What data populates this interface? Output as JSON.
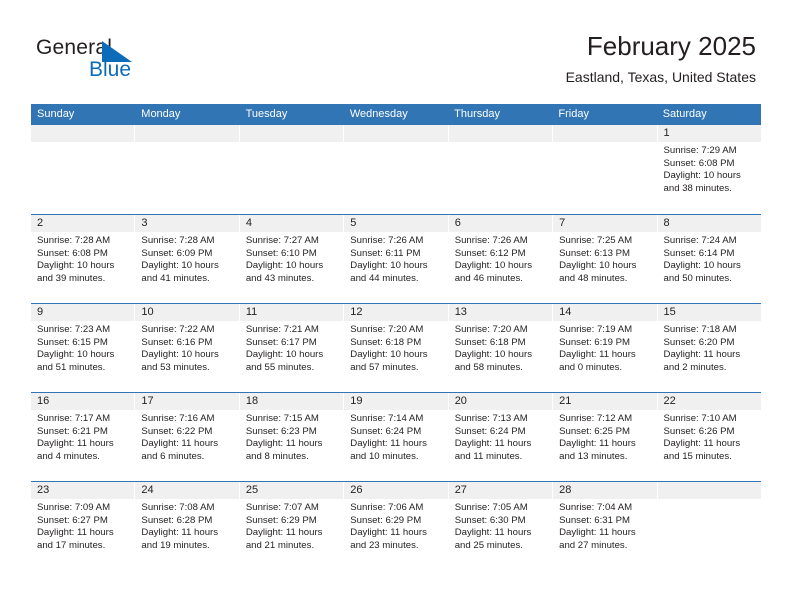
{
  "logo": {
    "word_one": "General",
    "word_two": "Blue",
    "triangle_color": "#0d6cb9",
    "text_color": "#231f20"
  },
  "header": {
    "title": "February 2025",
    "subtitle": "Eastland, Texas, United States"
  },
  "theme": {
    "header_blue": "#3175b4",
    "day_band_gray": "#f0f0f0",
    "text": "#231f20",
    "accent_blue": "#0d6cb9"
  },
  "weekdays": [
    "Sunday",
    "Monday",
    "Tuesday",
    "Wednesday",
    "Thursday",
    "Friday",
    "Saturday"
  ],
  "weeks": [
    [
      {
        "day": "",
        "sunrise": "",
        "sunset": "",
        "daylight": ""
      },
      {
        "day": "",
        "sunrise": "",
        "sunset": "",
        "daylight": ""
      },
      {
        "day": "",
        "sunrise": "",
        "sunset": "",
        "daylight": ""
      },
      {
        "day": "",
        "sunrise": "",
        "sunset": "",
        "daylight": ""
      },
      {
        "day": "",
        "sunrise": "",
        "sunset": "",
        "daylight": ""
      },
      {
        "day": "",
        "sunrise": "",
        "sunset": "",
        "daylight": ""
      },
      {
        "day": "1",
        "sunrise": "Sunrise: 7:29 AM",
        "sunset": "Sunset: 6:08 PM",
        "daylight": "Daylight: 10 hours and 38 minutes."
      }
    ],
    [
      {
        "day": "2",
        "sunrise": "Sunrise: 7:28 AM",
        "sunset": "Sunset: 6:08 PM",
        "daylight": "Daylight: 10 hours and 39 minutes."
      },
      {
        "day": "3",
        "sunrise": "Sunrise: 7:28 AM",
        "sunset": "Sunset: 6:09 PM",
        "daylight": "Daylight: 10 hours and 41 minutes."
      },
      {
        "day": "4",
        "sunrise": "Sunrise: 7:27 AM",
        "sunset": "Sunset: 6:10 PM",
        "daylight": "Daylight: 10 hours and 43 minutes."
      },
      {
        "day": "5",
        "sunrise": "Sunrise: 7:26 AM",
        "sunset": "Sunset: 6:11 PM",
        "daylight": "Daylight: 10 hours and 44 minutes."
      },
      {
        "day": "6",
        "sunrise": "Sunrise: 7:26 AM",
        "sunset": "Sunset: 6:12 PM",
        "daylight": "Daylight: 10 hours and 46 minutes."
      },
      {
        "day": "7",
        "sunrise": "Sunrise: 7:25 AM",
        "sunset": "Sunset: 6:13 PM",
        "daylight": "Daylight: 10 hours and 48 minutes."
      },
      {
        "day": "8",
        "sunrise": "Sunrise: 7:24 AM",
        "sunset": "Sunset: 6:14 PM",
        "daylight": "Daylight: 10 hours and 50 minutes."
      }
    ],
    [
      {
        "day": "9",
        "sunrise": "Sunrise: 7:23 AM",
        "sunset": "Sunset: 6:15 PM",
        "daylight": "Daylight: 10 hours and 51 minutes."
      },
      {
        "day": "10",
        "sunrise": "Sunrise: 7:22 AM",
        "sunset": "Sunset: 6:16 PM",
        "daylight": "Daylight: 10 hours and 53 minutes."
      },
      {
        "day": "11",
        "sunrise": "Sunrise: 7:21 AM",
        "sunset": "Sunset: 6:17 PM",
        "daylight": "Daylight: 10 hours and 55 minutes."
      },
      {
        "day": "12",
        "sunrise": "Sunrise: 7:20 AM",
        "sunset": "Sunset: 6:18 PM",
        "daylight": "Daylight: 10 hours and 57 minutes."
      },
      {
        "day": "13",
        "sunrise": "Sunrise: 7:20 AM",
        "sunset": "Sunset: 6:18 PM",
        "daylight": "Daylight: 10 hours and 58 minutes."
      },
      {
        "day": "14",
        "sunrise": "Sunrise: 7:19 AM",
        "sunset": "Sunset: 6:19 PM",
        "daylight": "Daylight: 11 hours and 0 minutes."
      },
      {
        "day": "15",
        "sunrise": "Sunrise: 7:18 AM",
        "sunset": "Sunset: 6:20 PM",
        "daylight": "Daylight: 11 hours and 2 minutes."
      }
    ],
    [
      {
        "day": "16",
        "sunrise": "Sunrise: 7:17 AM",
        "sunset": "Sunset: 6:21 PM",
        "daylight": "Daylight: 11 hours and 4 minutes."
      },
      {
        "day": "17",
        "sunrise": "Sunrise: 7:16 AM",
        "sunset": "Sunset: 6:22 PM",
        "daylight": "Daylight: 11 hours and 6 minutes."
      },
      {
        "day": "18",
        "sunrise": "Sunrise: 7:15 AM",
        "sunset": "Sunset: 6:23 PM",
        "daylight": "Daylight: 11 hours and 8 minutes."
      },
      {
        "day": "19",
        "sunrise": "Sunrise: 7:14 AM",
        "sunset": "Sunset: 6:24 PM",
        "daylight": "Daylight: 11 hours and 10 minutes."
      },
      {
        "day": "20",
        "sunrise": "Sunrise: 7:13 AM",
        "sunset": "Sunset: 6:24 PM",
        "daylight": "Daylight: 11 hours and 11 minutes."
      },
      {
        "day": "21",
        "sunrise": "Sunrise: 7:12 AM",
        "sunset": "Sunset: 6:25 PM",
        "daylight": "Daylight: 11 hours and 13 minutes."
      },
      {
        "day": "22",
        "sunrise": "Sunrise: 7:10 AM",
        "sunset": "Sunset: 6:26 PM",
        "daylight": "Daylight: 11 hours and 15 minutes."
      }
    ],
    [
      {
        "day": "23",
        "sunrise": "Sunrise: 7:09 AM",
        "sunset": "Sunset: 6:27 PM",
        "daylight": "Daylight: 11 hours and 17 minutes."
      },
      {
        "day": "24",
        "sunrise": "Sunrise: 7:08 AM",
        "sunset": "Sunset: 6:28 PM",
        "daylight": "Daylight: 11 hours and 19 minutes."
      },
      {
        "day": "25",
        "sunrise": "Sunrise: 7:07 AM",
        "sunset": "Sunset: 6:29 PM",
        "daylight": "Daylight: 11 hours and 21 minutes."
      },
      {
        "day": "26",
        "sunrise": "Sunrise: 7:06 AM",
        "sunset": "Sunset: 6:29 PM",
        "daylight": "Daylight: 11 hours and 23 minutes."
      },
      {
        "day": "27",
        "sunrise": "Sunrise: 7:05 AM",
        "sunset": "Sunset: 6:30 PM",
        "daylight": "Daylight: 11 hours and 25 minutes."
      },
      {
        "day": "28",
        "sunrise": "Sunrise: 7:04 AM",
        "sunset": "Sunset: 6:31 PM",
        "daylight": "Daylight: 11 hours and 27 minutes."
      },
      {
        "day": "",
        "sunrise": "",
        "sunset": "",
        "daylight": ""
      }
    ]
  ]
}
